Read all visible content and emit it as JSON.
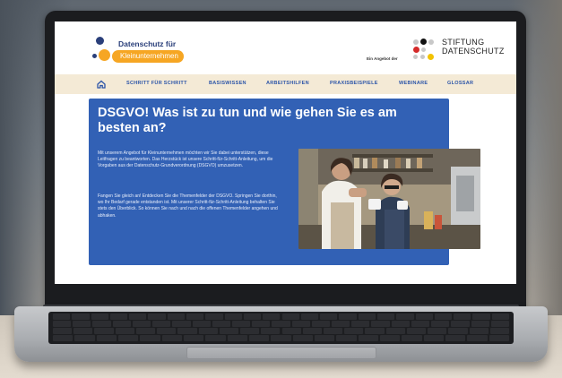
{
  "site": {
    "logo_title": "Datenschutz für",
    "logo_pill": "Kleinunternehmen",
    "stiftung_line1": "STIFTUNG",
    "stiftung_line2": "DATENSCHUTZ",
    "angebot": "Ein Angebot der"
  },
  "nav": {
    "home_icon": "home-icon",
    "items": [
      {
        "label": "SCHRITT FÜR SCHRITT"
      },
      {
        "label": "BASISWISSEN"
      },
      {
        "label": "ARBEITSHILFEN"
      },
      {
        "label": "PRAXISBEISPIELE"
      },
      {
        "label": "WEBINARE"
      },
      {
        "label": "GLOSSAR"
      }
    ]
  },
  "hero": {
    "title": "DSGVO! Was ist zu tun und wie gehen Sie es am besten an?",
    "paragraph1": "Mit unserem Angebot für Kleinunternehmen möchten wir Sie dabei unterstützen, diese Leitfragen zu beantworten. Das Herzstück ist unsere Schritt-für-Schritt-Anleitung, um die Vorgaben aus der Datenschutz-Grundverordnung (DSGVO) umzusetzen.",
    "paragraph2": "Fangen Sie gleich an! Entdecken Sie die Themenfelder der DSGVO. Springen Sie dorthin, wo Ihr Bedarf gerade entstanden ist. Mit unserer Schritt-für-Schritt-Anleitung behalten Sie stets den Überblick. So können Sie nach und nach die offenen Themenfelder angehen und abhaken."
  },
  "colors": {
    "brand_blue": "#3261b5",
    "nav_bg": "#f4ead6",
    "accent_orange": "#f6a623",
    "nav_text": "#2c55a8"
  }
}
